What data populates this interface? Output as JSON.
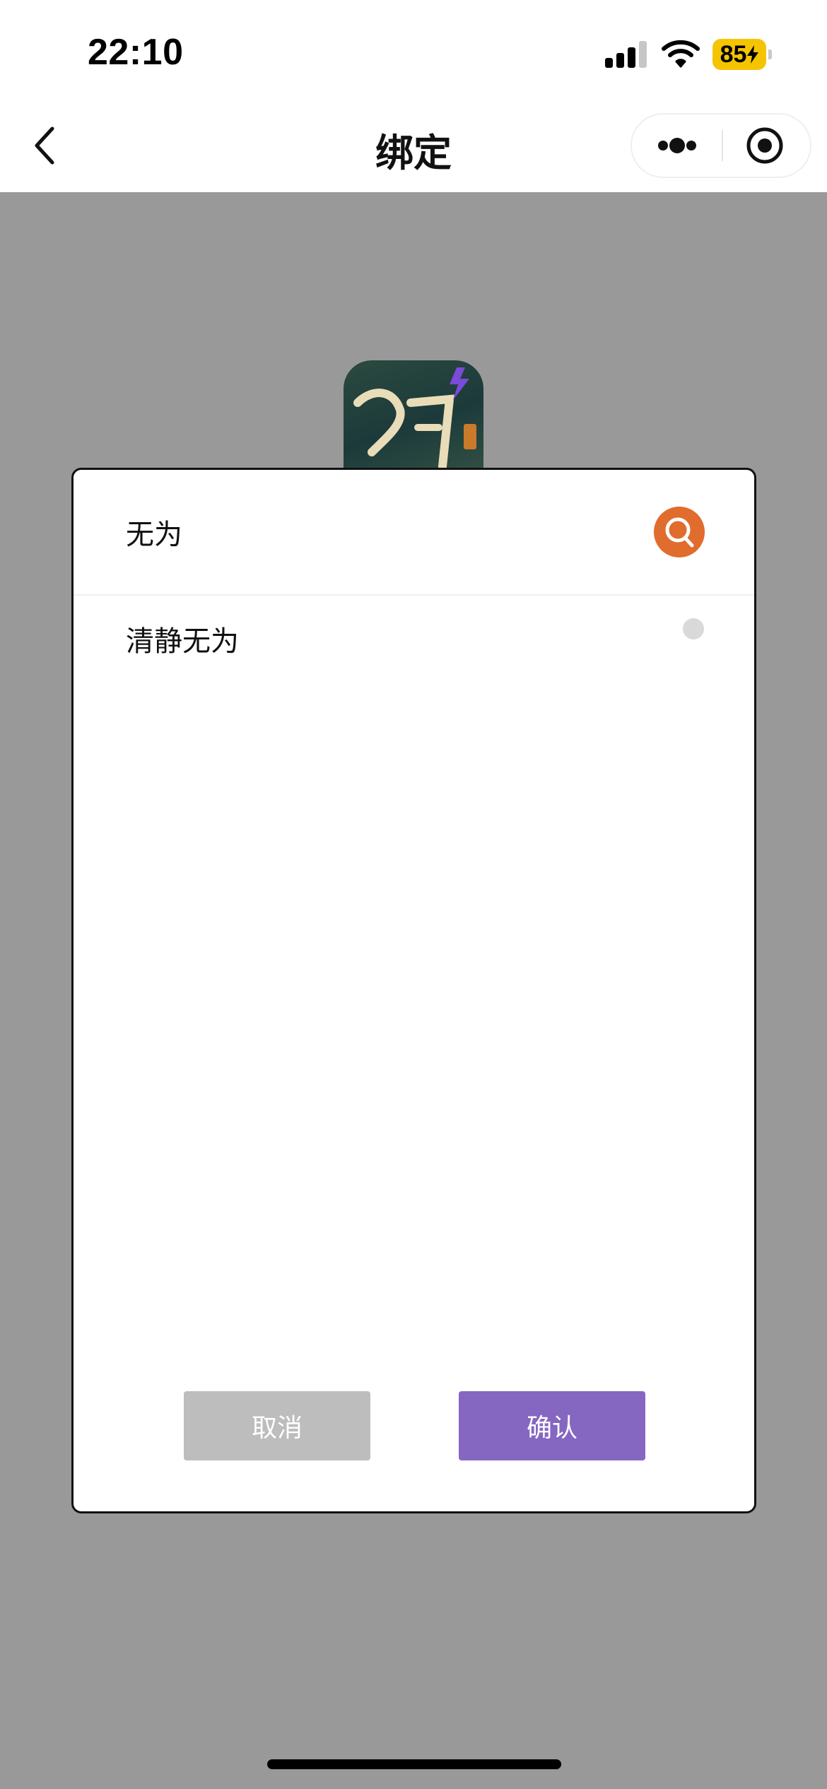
{
  "status_bar": {
    "time": "22:10",
    "battery_level": "85",
    "signal_icon": "cellular-signal-icon",
    "wifi_icon": "wifi-icon",
    "battery_icon": "battery-charging-icon"
  },
  "nav": {
    "title": "绑定",
    "back_icon": "chevron-left-icon",
    "more_icon": "more-dots-icon",
    "close_icon": "target-circle-icon"
  },
  "background": {
    "app_icon": "game-app-icon"
  },
  "dialog": {
    "search": {
      "value": "无为",
      "placeholder": "",
      "icon": "search-icon"
    },
    "results": [
      {
        "label": "清静无为",
        "selected": false
      }
    ],
    "cancel_label": "取消",
    "confirm_label": "确认"
  },
  "colors": {
    "overlay": "#999999",
    "search_button": "#e06c2d",
    "confirm_button": "#8567c2",
    "cancel_button": "#bdbdbd",
    "battery": "#f5c400"
  }
}
